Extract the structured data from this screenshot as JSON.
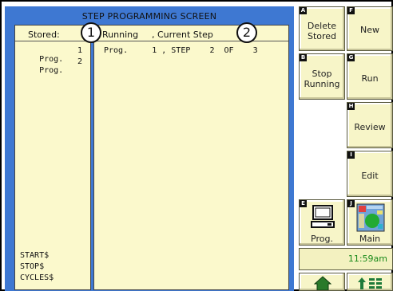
{
  "screen_title": "STEP PROGRAMMING SCREEN",
  "stored": {
    "header": "Stored:",
    "programs": [
      {
        "name": "Prog.",
        "num": "1"
      },
      {
        "name": "Prog.",
        "num": "2"
      }
    ],
    "footer": [
      "START$",
      "STOP$",
      "CYCLES$"
    ]
  },
  "running": {
    "header_running": "Running",
    "header_step": ", Current Step",
    "line": "Prog.     1 , STEP    2  OF    3"
  },
  "callouts": [
    "1",
    "2"
  ],
  "buttons": {
    "delete": {
      "key": "A",
      "label1": "Delete",
      "label2": "Stored"
    },
    "new": {
      "key": "F",
      "label": "New"
    },
    "stop": {
      "key": "B",
      "label1": "Stop",
      "label2": "Running"
    },
    "run": {
      "key": "G",
      "label": "Run"
    },
    "review": {
      "key": "H",
      "label": "Review"
    },
    "edit": {
      "key": "I",
      "label": "Edit"
    },
    "prog": {
      "key": "E",
      "label": "Prog."
    },
    "main": {
      "key": "J",
      "label": "Main"
    }
  },
  "clock": "11:59am",
  "colors": {
    "panel": "#fbf9cc",
    "background": "#3e78d2",
    "clock_text": "#1a8a1a"
  }
}
